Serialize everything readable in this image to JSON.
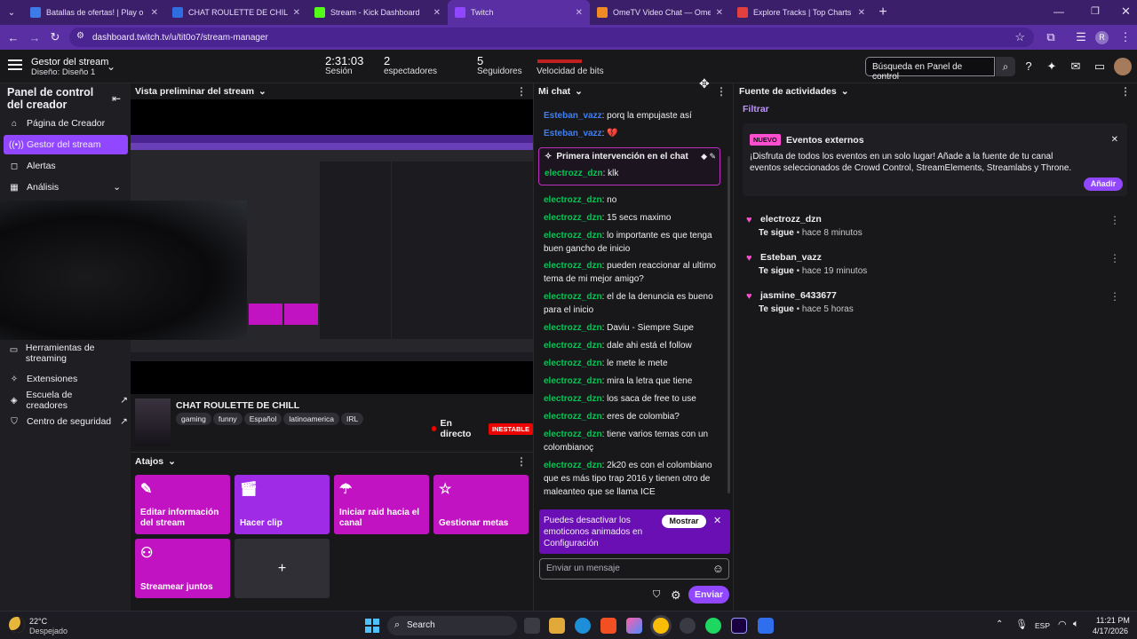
{
  "browser": {
    "tabs": [
      {
        "title": "Batallas de ofertas! | Play o",
        "color": "#3d7be8"
      },
      {
        "title": "CHAT ROULETTE DE CHILL - Re",
        "color": "#2f6ee0"
      },
      {
        "title": "Stream - Kick Dashboard",
        "color": "#53fc18"
      },
      {
        "title": "Twitch",
        "color": "#9146ff"
      },
      {
        "title": "OmeTV Video Chat — Ome",
        "color": "#f08a24"
      },
      {
        "title": "Explore Tracks | Top Charts | To",
        "color": "#e23f3f"
      }
    ],
    "url": "dashboard.twitch.tv/u/tit0o7/stream-manager",
    "profile_initial": "R"
  },
  "topbar": {
    "title": "Gestor del stream",
    "subtitle": "Diseño: Diseño 1",
    "stats": [
      {
        "value": "2:31:03",
        "label": "Sesión"
      },
      {
        "value": "2",
        "label": "espectadores"
      },
      {
        "value": "5",
        "label": "Seguidores"
      },
      {
        "value": "",
        "label": "Velocidad de bits"
      }
    ],
    "search_placeholder": "Búsqueda en Panel de control"
  },
  "sidebar": {
    "title": "Panel de control del creador",
    "items": [
      {
        "label": "Página de Creador",
        "icon": "home-icon"
      },
      {
        "label": "Gestor del stream",
        "icon": "broadcast-icon"
      },
      {
        "label": "Alertas",
        "icon": "bell-icon"
      },
      {
        "label": "Análisis",
        "icon": "chart-icon"
      }
    ],
    "bottom_items": [
      {
        "label": "Herramientas de streaming"
      },
      {
        "label": "Extensiones"
      },
      {
        "label": "Escuela de creadores"
      },
      {
        "label": "Centro de seguridad"
      }
    ]
  },
  "preview": {
    "header": "Vista preliminar del stream",
    "stream_title": "CHAT ROULETTE DE CHILL",
    "tags": [
      "gaming",
      "funny",
      "Español",
      "latinoamerica",
      "IRL"
    ],
    "live_label": "En directo",
    "status_badge": "INESTABLE"
  },
  "shortcuts": {
    "header": "Atajos",
    "items": [
      {
        "label": "Editar información del stream",
        "icon": "pencil-icon"
      },
      {
        "label": "Hacer clip",
        "icon": "clapper-icon"
      },
      {
        "label": "Iniciar raid hacia el canal",
        "icon": "parachute-icon"
      },
      {
        "label": "Gestionar metas",
        "icon": "star-icon"
      },
      {
        "label": "Streamear juntos",
        "icon": "add-person-icon"
      },
      {
        "label": "+",
        "icon": "plus-icon"
      }
    ]
  },
  "chat": {
    "header": "Mi chat",
    "highlight_title": "Primera intervención en el chat",
    "highlight_user": "electrozz_dzn",
    "highlight_text": "klk",
    "messages": [
      {
        "user": "Esteban_vazz",
        "text": "porq la empujaste así",
        "color": "blue"
      },
      {
        "user": "Esteban_vazz",
        "text": "💔",
        "color": "blue"
      },
      {
        "user": "electrozz_dzn",
        "text": "no",
        "color": "green"
      },
      {
        "user": "electrozz_dzn",
        "text": "15 secs maximo",
        "color": "green"
      },
      {
        "user": "electrozz_dzn",
        "text": "lo importante es que tenga buen gancho de inicio",
        "color": "green"
      },
      {
        "user": "electrozz_dzn",
        "text": "pueden reaccionar al ultimo tema de mi mejor amigo?",
        "color": "green"
      },
      {
        "user": "electrozz_dzn",
        "text": "el de la denuncia es bueno para el inicio",
        "color": "green"
      },
      {
        "user": "electrozz_dzn",
        "text": "Daviu - Siempre Supe",
        "color": "green"
      },
      {
        "user": "electrozz_dzn",
        "text": "dale ahi está el follow",
        "color": "green"
      },
      {
        "user": "electrozz_dzn",
        "text": "le mete le mete",
        "color": "green"
      },
      {
        "user": "electrozz_dzn",
        "text": "mira la letra que tiene",
        "color": "green"
      },
      {
        "user": "electrozz_dzn",
        "text": "los saca de free to use",
        "color": "green"
      },
      {
        "user": "electrozz_dzn",
        "text": "eres de colombia?",
        "color": "green"
      },
      {
        "user": "electrozz_dzn",
        "text": "tiene varios temas con un colombianoç",
        "color": "green"
      },
      {
        "user": "electrozz_dzn",
        "text": "2k20 es con el colombiano que es más tipo trap 2016 y tienen otro de maleanteo que se llama ICE",
        "color": "green"
      }
    ],
    "notice_text": "Puedes desactivar los emoticonos animados en Configuración",
    "notice_button": "Mostrar",
    "input_placeholder": "Enviar un mensaje",
    "send_label": "Enviar"
  },
  "activity": {
    "header": "Fuente de actividades",
    "filter_label": "Filtrar",
    "card": {
      "badge": "NUEVO",
      "title": "Eventos externos",
      "body": "¡Disfruta de todos los eventos en un solo lugar! Añade a la fuente de tu canal eventos seleccionados de Crowd Control, StreamElements, Streamlabs y Throne.",
      "button": "Añadir"
    },
    "events": [
      {
        "user": "electrozz_dzn",
        "action": "Te sigue",
        "time": "hace 8 minutos"
      },
      {
        "user": "Esteban_vazz",
        "action": "Te sigue",
        "time": "hace 19 minutos"
      },
      {
        "user": "jasmine_6433677",
        "action": "Te sigue",
        "time": "hace 5 horas"
      }
    ]
  },
  "taskbar": {
    "weather_temp": "22°C",
    "weather_desc": "Despejado",
    "search_label": "Search",
    "lang": "ESP",
    "time": "11:21 PM",
    "date": "4/17/2026"
  },
  "colors": {
    "accent": "#9147ff",
    "shortcut_magenta": "#c213c3",
    "user_green": "#00c853",
    "user_blue": "#3f7ff5"
  }
}
